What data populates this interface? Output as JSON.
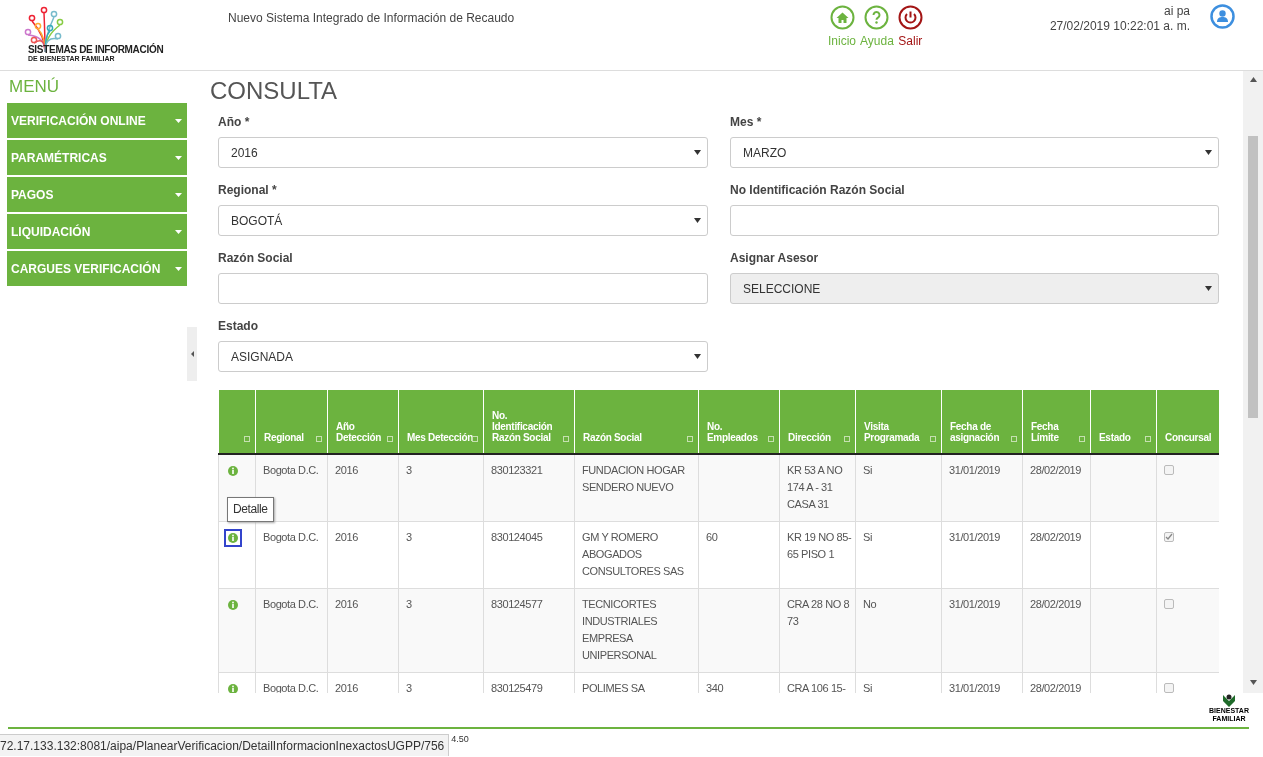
{
  "header": {
    "logo": {
      "title": "SISTEMAS DE INFORMACIÓN",
      "subtitle": "DE BIENESTAR FAMILIAR"
    },
    "system_name": "Nuevo Sistema Integrado de Información de Recaudo",
    "nav": [
      {
        "label": "Inicio",
        "kind": "home"
      },
      {
        "label": "Ayuda",
        "kind": "help"
      },
      {
        "label": "Salir",
        "kind": "exit"
      }
    ],
    "user": {
      "name": "ai pa",
      "datetime": "27/02/2019 10:22:01 a. m."
    }
  },
  "sidebar": {
    "heading": "MENÚ",
    "items": [
      {
        "label": "VERIFICACIÓN ONLINE"
      },
      {
        "label": "PARAMÉTRICAS"
      },
      {
        "label": "PAGOS"
      },
      {
        "label": "LIQUIDACIÓN"
      },
      {
        "label": "CARGUES VERIFICACIÓN"
      }
    ]
  },
  "page": {
    "title": "CONSULTA",
    "fields": [
      {
        "label": "Año *",
        "kind": "select",
        "value": "2016",
        "disabled": false
      },
      {
        "label": "Mes *",
        "kind": "select",
        "value": "MARZO",
        "disabled": false
      },
      {
        "label": "Regional *",
        "kind": "select",
        "value": "BOGOTÁ",
        "disabled": false
      },
      {
        "label": "No Identificación Razón Social",
        "kind": "text",
        "disabled": false
      },
      {
        "label": "Razón Social",
        "kind": "text",
        "disabled": false
      },
      {
        "label": "Asignar Asesor",
        "kind": "select",
        "value": "SELECCIONE",
        "disabled": true
      },
      {
        "label": "Estado",
        "kind": "select",
        "value": "ASIGNADA",
        "disabled": false
      }
    ]
  },
  "table": {
    "columns": [
      {
        "sortable": true
      },
      {
        "label": "Regional",
        "sortable": true
      },
      {
        "label": "Año Detección",
        "sortable": true
      },
      {
        "label": "Mes Detección",
        "sortable": true
      },
      {
        "label": "No. Identificación Razón Social",
        "sortable": true
      },
      {
        "label": "Razón Social",
        "sortable": true
      },
      {
        "label": "No. Empleados",
        "sortable": true
      },
      {
        "label": "Dirección",
        "sortable": true
      },
      {
        "label": "Visita Programada",
        "sortable": true
      },
      {
        "label": "Fecha de asignación",
        "sortable": true
      },
      {
        "label": "Fecha Límite",
        "sortable": true
      },
      {
        "label": "Estado",
        "sortable": true
      },
      {
        "label": "Concursal",
        "sortable": false
      }
    ],
    "rows": [
      {
        "focused": false,
        "cells": [
          "",
          "Bogota D.C.",
          "2016",
          "3",
          "830123321",
          "FUNDACION HOGAR SENDERO NUEVO",
          "",
          "KR 53 A NO 174 A - 31 CASA 31",
          "Si",
          "31/01/2019",
          "28/02/2019",
          ""
        ],
        "concursal": {
          "checked": false
        }
      },
      {
        "focused": true,
        "cells": [
          "",
          "Bogota D.C.",
          "2016",
          "3",
          "830124045",
          "GM Y ROMERO ABOGADOS CONSULTORES SAS",
          "60",
          "KR 19 NO 85-65 PISO 1",
          "Si",
          "31/01/2019",
          "28/02/2019",
          ""
        ],
        "concursal": {
          "checked": true
        }
      },
      {
        "focused": false,
        "cells": [
          "",
          "Bogota D.C.",
          "2016",
          "3",
          "830124577",
          "TECNICORTES INDUSTRIALES EMPRESA UNIPERSONAL",
          "",
          "CRA 28 NO 8 73",
          "No",
          "31/01/2019",
          "28/02/2019",
          ""
        ],
        "concursal": {
          "checked": false
        }
      },
      {
        "focused": false,
        "cells": [
          "",
          "Bogota D.C.",
          "2016",
          "3",
          "830125479",
          "POLIMES SA",
          "340",
          "CRA 106 15-",
          "Si",
          "31/01/2019",
          "28/02/2019",
          ""
        ],
        "concursal": {
          "checked": false
        }
      }
    ]
  },
  "tooltip": "Detalle",
  "footer": {
    "logo_text": "BIENESTAR FAMILIAR",
    "fragment": "4.50"
  },
  "status_url": "72.17.133.132:8081/aipa/PlanearVerificacion/DetailInformacionInexactosUGPP/756"
}
